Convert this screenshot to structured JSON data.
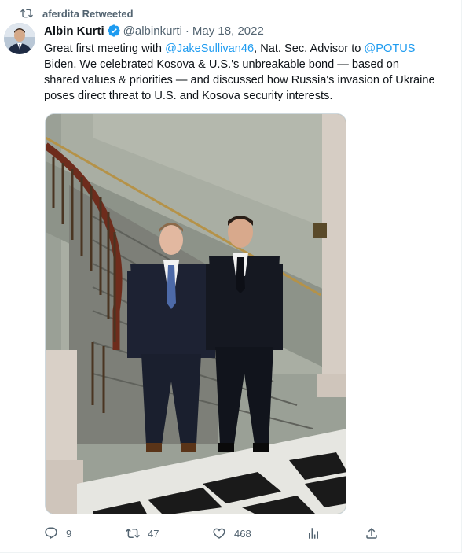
{
  "retweet": {
    "label": "aferdita Retweeted",
    "icon": "retweet-icon"
  },
  "author": {
    "name": "Albin Kurti",
    "handle": "@albinkurti",
    "separator": "·",
    "date": "May 18, 2022",
    "verified_icon": "verified-badge-icon"
  },
  "tweet": {
    "parts": {
      "t1": "Great first meeting with ",
      "m1": "@JakeSullivan46",
      "t2": ", Nat. Sec. Advisor to ",
      "m2": "@POTUS",
      "t3": " Biden. We celebrated Kosova & U.S.'s unbreakable bond — based on shared values & priorities — and discussed how Russia's invasion of Ukraine poses direct threat to U.S. and Kosova security interests."
    }
  },
  "actions": {
    "reply_count": "9",
    "retweet_count": "47",
    "like_count": "468"
  },
  "colors": {
    "accent": "#1d9bf0",
    "text": "#0f1419",
    "muted": "#536471"
  }
}
